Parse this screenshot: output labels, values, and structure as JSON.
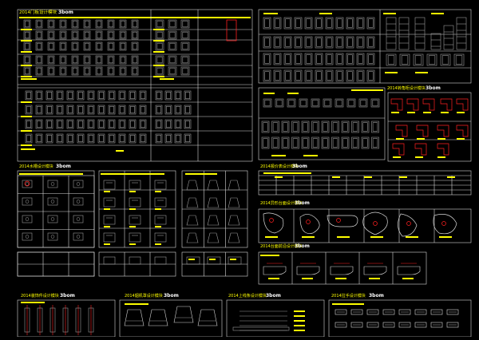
{
  "drawing": {
    "background": "#000000",
    "colors": {
      "frame": "#d8d8d8",
      "fixture": "#9a9a9a",
      "highlight": "#ffff00",
      "dimension": "#ff2020",
      "brand": "#ffffff"
    },
    "brand_mark": "3bom",
    "section_titles": {
      "cabinet_doors": "2014门板设计模块",
      "corner_cabinets": "2014转角柜设计模块",
      "sinks": "2014水槽设计模块",
      "price_table": "2014报价表设计模块",
      "countertop_shapes": "2014异形台面设计模块",
      "countertop_edges": "2014台面前沿设计模块",
      "decorations": "2014装饰件设计模块",
      "range_hoods": "2014烟机罩设计模块",
      "upper_lines": "2014上线条设计模块",
      "handles": "2014拉手设计模块"
    }
  }
}
